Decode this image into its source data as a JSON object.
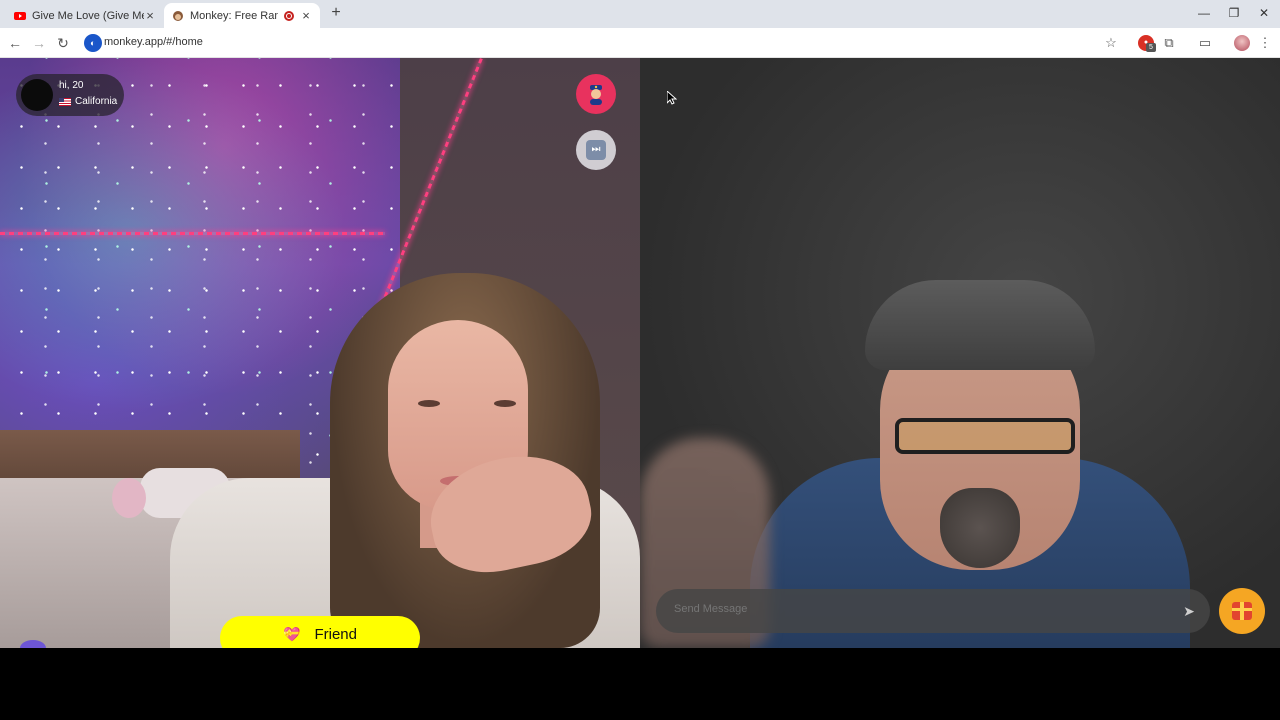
{
  "browser": {
    "tabs": [
      {
        "title": "Give Me Love (Give Me Peace o",
        "icon": "youtube-icon",
        "active": false
      },
      {
        "title": "Monkey: Free Random Vide",
        "icon": "monkey-icon",
        "active": true,
        "recording": true
      }
    ],
    "url": "monkey.app/#/home",
    "extension_badge": "5"
  },
  "app": {
    "user": {
      "greeting": "hi, 20",
      "location": "California"
    },
    "friend_button": {
      "label": "Friend",
      "icon": "heart-gift-icon"
    },
    "message": {
      "placeholder": "Send Message"
    },
    "colors": {
      "accent_yellow": "#ffff00",
      "report_red": "#e8325e",
      "gift_orange": "#f5a623"
    }
  }
}
